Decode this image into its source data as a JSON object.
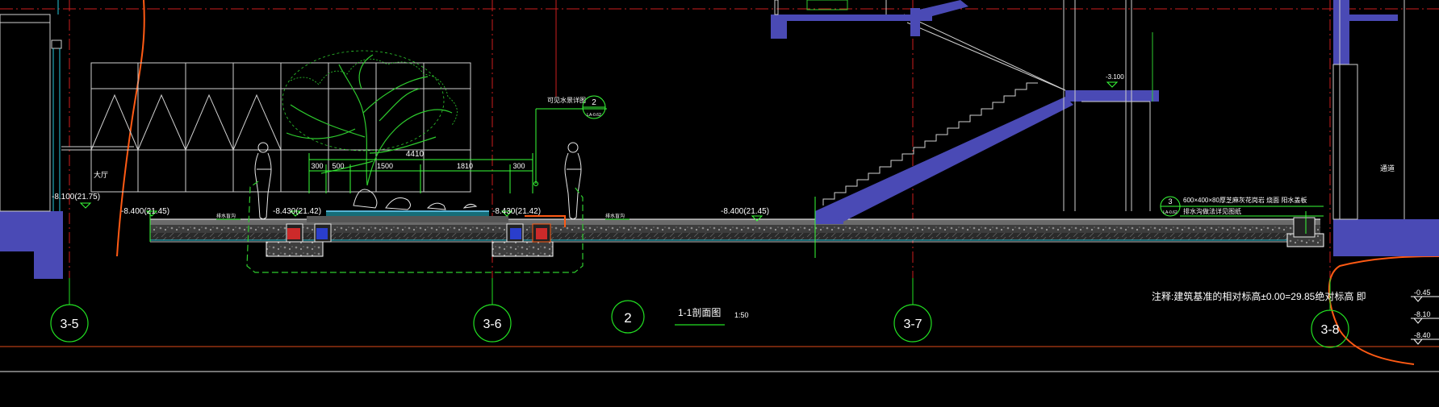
{
  "colors": {
    "background": "#000000",
    "grid_axis": "#cc1e1e",
    "slab_fill": "#6a6a6a",
    "wall_fill": "#4a4ab5",
    "outline": "#ffffff",
    "vegetation": "#2ecc2e",
    "dimension": "#39ff39",
    "cyan": "#26c6da",
    "orange": "#ff5a14",
    "axis_bubble": "#22e022",
    "text": "#ffffff"
  },
  "axis_labels": {
    "a1": "3-5",
    "a2": "3-6",
    "a3": "3-7",
    "a4": "3-8"
  },
  "section_title": {
    "number": "2",
    "name": "1-1剖面图",
    "scale": "1:50"
  },
  "elevations": {
    "left_room": "-8.100(21.75)",
    "e1": "-8.400(21.45)",
    "e2": "-8.430(21.42)",
    "e3": "-8.430(21.42)",
    "e4": "-8.400(21.45)",
    "stair_landing": "-3.100",
    "bottom_right": [
      "-0.45",
      "-8.10",
      "-8.40"
    ]
  },
  "room_labels": {
    "hall": "大厅",
    "corridor": "通道"
  },
  "dimensions": {
    "total": "4410",
    "parts": [
      "300",
      "500",
      "1500",
      "1810",
      "300"
    ]
  },
  "callouts": {
    "water_detail_label": "可见水景详图",
    "water_detail_num": "2",
    "water_detail_ref": "LA-0.62",
    "paving_num": "3",
    "paving_ref": "LA-0.62",
    "paving_line1": "600×400×80厚芝麻灰花岗岩  烧面  阳水盖板",
    "paving_line2": "排水沟做法详见图纸",
    "small_label_1": "排水盲沟",
    "small_label_2": "排水盲沟"
  },
  "note": "注释:建筑基准的相对标高±0.00=29.85绝对标高 即"
}
